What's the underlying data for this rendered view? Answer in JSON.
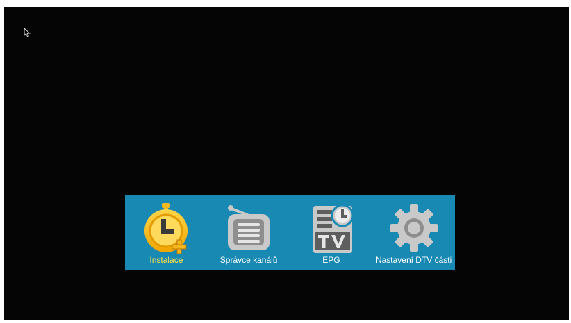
{
  "menu": {
    "items": [
      {
        "label": "Instalace",
        "icon": "stopwatch-plus-icon",
        "selected": true
      },
      {
        "label": "Správce kanálů",
        "icon": "radio-icon",
        "selected": false
      },
      {
        "label": "EPG",
        "icon": "tv-guide-icon",
        "selected": false
      },
      {
        "label": "Nastavení DTV části",
        "icon": "gear-icon",
        "selected": false
      }
    ]
  },
  "colors": {
    "background": "#050505",
    "menu_bar": "#1789b3",
    "selected_text": "#ffe24a",
    "text": "#ffffff",
    "icon_gray": "#c9c9c9",
    "icon_yellow": "#f6b820"
  }
}
